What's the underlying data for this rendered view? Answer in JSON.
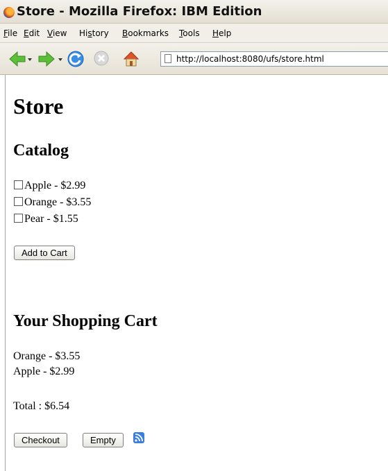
{
  "window": {
    "title": "Store - Mozilla Firefox: IBM Edition"
  },
  "menubar": {
    "items": [
      {
        "label": "File",
        "accel": "F",
        "rest": "ile"
      },
      {
        "label": "Edit",
        "accel": "E",
        "rest": "dit"
      },
      {
        "label": "View",
        "accel": "V",
        "rest": "iew"
      },
      {
        "label": "History",
        "pre": "Hi",
        "accel": "s",
        "rest": "tory"
      },
      {
        "label": "Bookmarks",
        "accel": "B",
        "rest": "ookmarks"
      },
      {
        "label": "Tools",
        "accel": "T",
        "rest": "ools"
      },
      {
        "label": "Help",
        "accel": "H",
        "rest": "elp"
      }
    ]
  },
  "navbar": {
    "url": "http://localhost:8080/ufs/store.html",
    "icons": [
      "back-icon",
      "forward-icon",
      "reload-icon",
      "stop-icon",
      "home-icon",
      "page-icon"
    ]
  },
  "page": {
    "title": "Store",
    "catalog_heading": "Catalog",
    "catalog_items": [
      {
        "label": "Apple - $2.99",
        "checked": false
      },
      {
        "label": "Orange - $3.55",
        "checked": false
      },
      {
        "label": "Pear - $1.55",
        "checked": false
      }
    ],
    "add_button": "Add to Cart",
    "cart_heading": "Your Shopping Cart",
    "cart_items": [
      "Orange - $3.55",
      "Apple - $2.99"
    ],
    "total": "Total : $6.54",
    "checkout_button": "Checkout",
    "empty_button": "Empty",
    "feed_icon": "rss-feed-icon"
  }
}
